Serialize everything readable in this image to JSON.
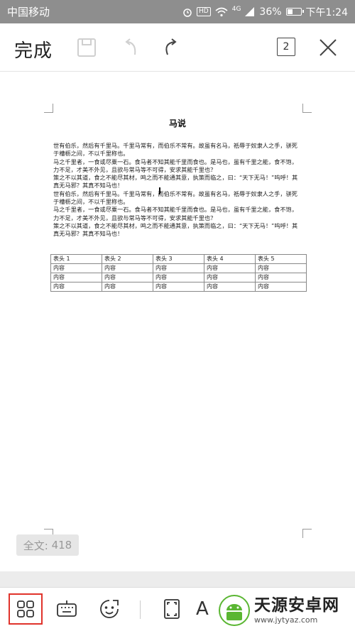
{
  "status_bar": {
    "carrier": "中国移动",
    "network": "4G",
    "hd_badge": "HD",
    "battery_text": "36%",
    "battery_level": 0.36,
    "time": "下午1:24"
  },
  "toolbar": {
    "done_label": "完成",
    "page_count": "2",
    "icons": [
      "save-icon",
      "undo-icon",
      "redo-icon",
      "close-icon"
    ]
  },
  "document": {
    "title": "马说",
    "paragraphs": [
      "世有伯乐，然后有千里马。千里马常有，而伯乐不常有。故虽有名马，祇辱于奴隶人之手，骈死于槽枥之间，不以千里称也。",
      "马之千里者，一食或尽粟一石。食马者不知其能千里而食也。是马也，虽有千里之能，食不饱，力不足，才美不外见，且欲与常马等不可得，安求其能千里也？",
      "策之不以其道，食之不能尽其材，鸣之而不能通其意，执策而临之，曰：“天下无马！”呜呼！其真无马邪？其真不知马也！",
      " 世有伯乐，然后有千里马。千里马常有，而伯乐不常有。故虽有名马，祇辱于奴隶人之手，骈死于槽枥之间，不以千里称也。",
      "马之千里者，一食或尽粟一石。食马者不知其能千里而食也。是马也，虽有千里之能，食不饱，力不足，才美不外见，且欲与常马等不可得，安求其能千里也？",
      "策之不以其道，食之不能尽其材，鸣之而不能通其意，执策而临之，曰：“天下无马！”呜呼！其真无马邪？其真不知马也！"
    ],
    "table": {
      "headers": [
        "表头 1",
        "表头 2",
        "表头 3",
        "表头 4",
        "表头 5"
      ],
      "rows": [
        [
          "内容",
          "内容",
          "内容",
          "内容",
          "内容"
        ],
        [
          "内容",
          "内容",
          "内容",
          "内容",
          "内容"
        ],
        [
          "内容",
          "内容",
          "内容",
          "内容",
          "内容"
        ]
      ]
    }
  },
  "word_count": {
    "label": "全文:",
    "value": "418"
  },
  "bottom_bar": {
    "items": [
      "apps-icon",
      "keyboard-icon",
      "emoji-icon",
      "fullscreen-icon",
      "font-icon"
    ],
    "font_glyph": "A"
  },
  "colors": {
    "active_outline": "#e0332b",
    "status_bar_bg": "#8e8e8e"
  }
}
